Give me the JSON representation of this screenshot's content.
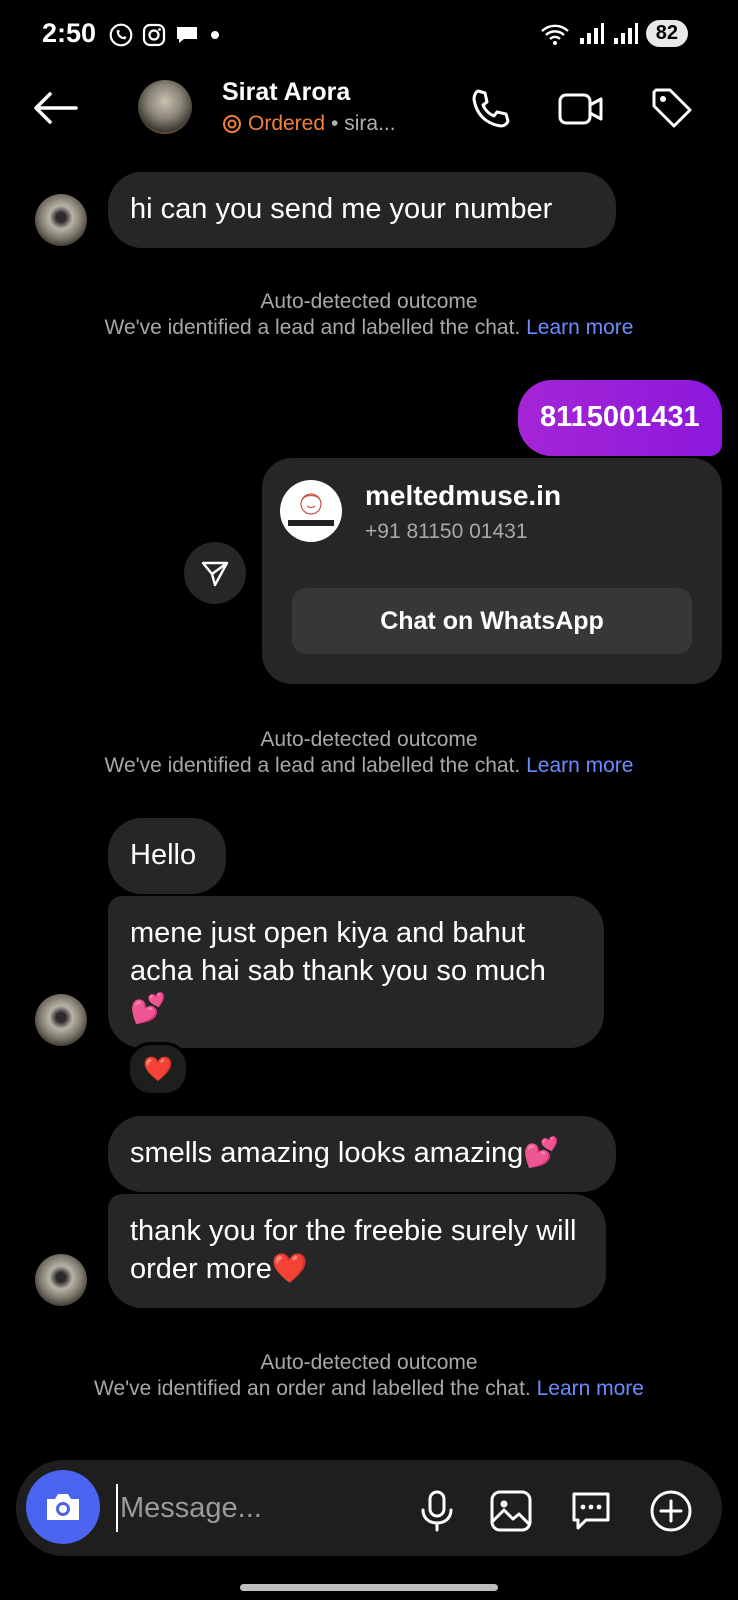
{
  "status_bar": {
    "time": "2:50",
    "battery": "82",
    "notification_icons": [
      "whatsapp-icon",
      "instagram-icon",
      "chat-icon",
      "dot-icon"
    ],
    "system_icons": [
      "wifi-icon",
      "signal-icon",
      "signal-icon",
      "battery-icon"
    ]
  },
  "header": {
    "name": "Sirat Arora",
    "status_label": "Ordered",
    "username_prefix": "• sira...",
    "icons": [
      "back-arrow-icon",
      "phone-icon",
      "video-icon",
      "tag-icon"
    ]
  },
  "messages": [
    {
      "from": "them",
      "text": "hi can you send me your number"
    },
    {
      "type": "system",
      "title": "Auto-detected outcome",
      "text": "We've identified a lead and labelled the chat.",
      "link": "Learn more"
    },
    {
      "from": "me",
      "text": "8115001431"
    },
    {
      "type": "card",
      "title": "meltedmuse.in",
      "phone": "+91 81150 01431",
      "button": "Chat on WhatsApp"
    },
    {
      "type": "system",
      "title": "Auto-detected outcome",
      "text": "We've identified a lead and labelled the chat.",
      "link": "Learn more"
    },
    {
      "from": "them",
      "text": "Hello"
    },
    {
      "from": "them",
      "text": "mene just open kiya and bahut acha hai sab thank you so much 💕",
      "reaction": "❤️"
    },
    {
      "from": "them",
      "text": "smells amazing looks amazing💕"
    },
    {
      "from": "them",
      "text": "thank you for the freebie surely will order more❤️"
    },
    {
      "type": "system",
      "title": "Auto-detected outcome",
      "text": "We've identified an order and labelled the chat.",
      "link": "Learn more"
    }
  ],
  "composer": {
    "placeholder": "Message...",
    "icons": [
      "camera-icon",
      "microphone-icon",
      "gallery-icon",
      "sticker-chat-icon",
      "plus-icon"
    ]
  },
  "colors": {
    "background": "#000000",
    "bubble_them": "#262626",
    "bubble_me": "#9b1fd9",
    "ordered": "#f0803c",
    "link": "#6b8cff",
    "camera_button": "#4a64f0"
  }
}
